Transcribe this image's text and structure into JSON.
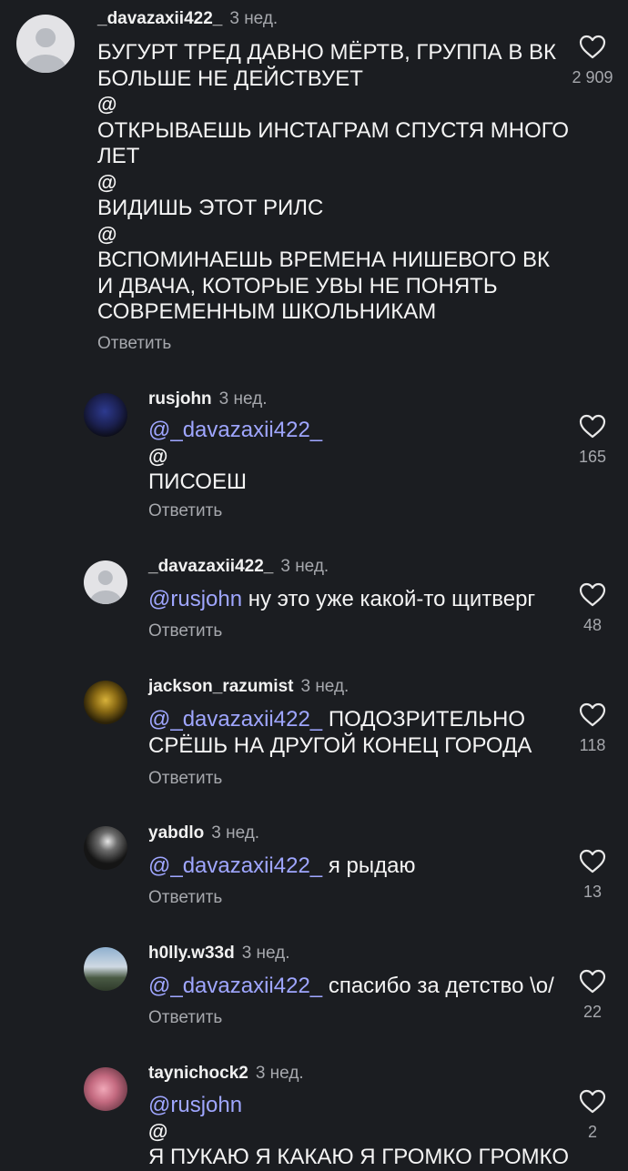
{
  "colors": {
    "background": "#1b1d21",
    "mention": "#9fa6ff",
    "muted": "#a6a8ad"
  },
  "reply_label": "Ответить",
  "threads_glyph": "@",
  "comments": [
    {
      "username": "_davazaxii422_",
      "time": "3 нед.",
      "avatar": "default-avatar",
      "lines": [
        {
          "text": "БУГУРТ ТРЕД ДАВНО МЁРТВ, ГРУППА В ВК"
        },
        {
          "text": "БОЛЬШЕ НЕ ДЕЙСТВУЕТ"
        },
        {
          "threads": true
        },
        {
          "text": "ОТКРЫВАЕШЬ ИНСТАГРАМ СПУСТЯ МНОГО"
        },
        {
          "text": "ЛЕТ"
        },
        {
          "threads": true
        },
        {
          "text": "ВИДИШЬ ЭТОТ РИЛС"
        },
        {
          "threads": true
        },
        {
          "text": "ВСПОМИНАЕШЬ ВРЕМЕНА НИШЕВОГО ВК"
        },
        {
          "text": "И ДВАЧА, КОТОРЫЕ УВЫ НЕ ПОНЯТЬ"
        },
        {
          "text": "СОВРЕМЕННЫМ ШКОЛЬНИКАМ"
        }
      ],
      "likes": "2 909"
    },
    {
      "username": "rusjohn",
      "time": "3 нед.",
      "avatar": "photo-avatar",
      "lines": [
        {
          "mention": "@_davazaxii422_"
        },
        {
          "threads": true
        },
        {
          "text": "ПИСОЕШ"
        }
      ],
      "likes": "165"
    },
    {
      "username": "_davazaxii422_",
      "time": "3 нед.",
      "avatar": "default-avatar",
      "lines": [
        {
          "mention": "@rusjohn",
          "text": " ну это уже какой-то щитверг"
        }
      ],
      "likes": "48"
    },
    {
      "username": "jackson_razumist",
      "time": "3 нед.",
      "avatar": "photo-avatar",
      "lines": [
        {
          "mention": "@_davazaxii422_",
          "text": " ПОДОЗРИТЕЛЬНО"
        },
        {
          "text": "СРЁШЬ НА ДРУГОЙ КОНЕЦ ГОРОДА"
        }
      ],
      "likes": "118"
    },
    {
      "username": "yabdlo",
      "time": "3 нед.",
      "avatar": "photo-avatar",
      "lines": [
        {
          "mention": "@_davazaxii422_",
          "text": " я рыдаю"
        }
      ],
      "likes": "13"
    },
    {
      "username": "h0lly.w33d",
      "time": "3 нед.",
      "avatar": "photo-avatar",
      "lines": [
        {
          "mention": "@_davazaxii422_",
          "text": " спасибо за детство \\o/"
        }
      ],
      "likes": "22"
    },
    {
      "username": "taynichock2",
      "time": "3 нед.",
      "avatar": "photo-avatar",
      "lines": [
        {
          "mention": "@rusjohn"
        },
        {
          "threads": true
        },
        {
          "text": "Я ПУКАЮ Я КАКАЮ Я ГРОМКО ГРОМКО"
        }
      ],
      "likes": "2"
    }
  ]
}
